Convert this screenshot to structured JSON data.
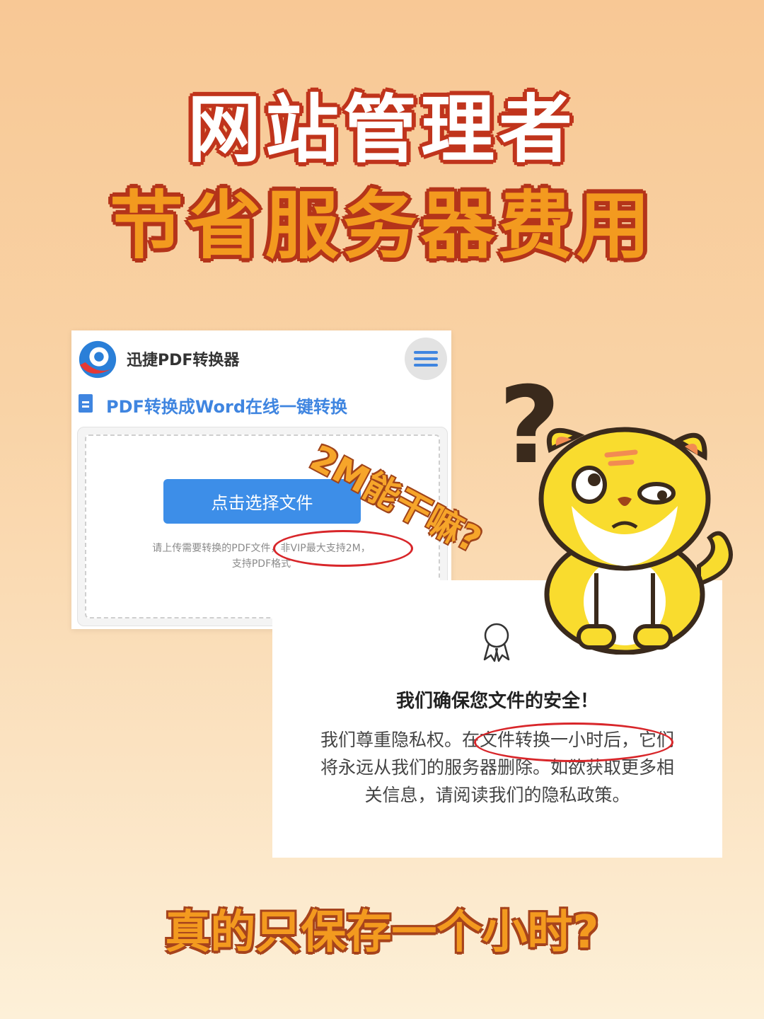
{
  "headline": {
    "line1": "网站管理者",
    "line2": "节省服务器费用"
  },
  "converter_panel": {
    "brand_name": "迅捷PDF转换器",
    "menu_icon": "hamburger-menu-icon",
    "section_title": "PDF转换成Word在线一键转换",
    "choose_button": "点击选择文件",
    "hint_line1": "请上传需要转换的PDF文件，非VIP最大支持2M，",
    "hint_line2": "支持PDF格式"
  },
  "security_panel": {
    "icon": "award-ribbon-icon",
    "title": "我们确保您文件的安全！",
    "body": "我们尊重隐私权。在文件转换一小时后，它们将永远从我们的服务器删除。如欲获取更多相关信息，请阅读我们的隐私政策。"
  },
  "annotation": {
    "note": "2M能干嘛?",
    "question_mark": "?"
  },
  "bottom_caption": "真的只保存一个小时?",
  "colors": {
    "accent_blue": "#3d8ee8",
    "highlight_red": "#d8262a",
    "title_orange": "#f39a1f"
  }
}
